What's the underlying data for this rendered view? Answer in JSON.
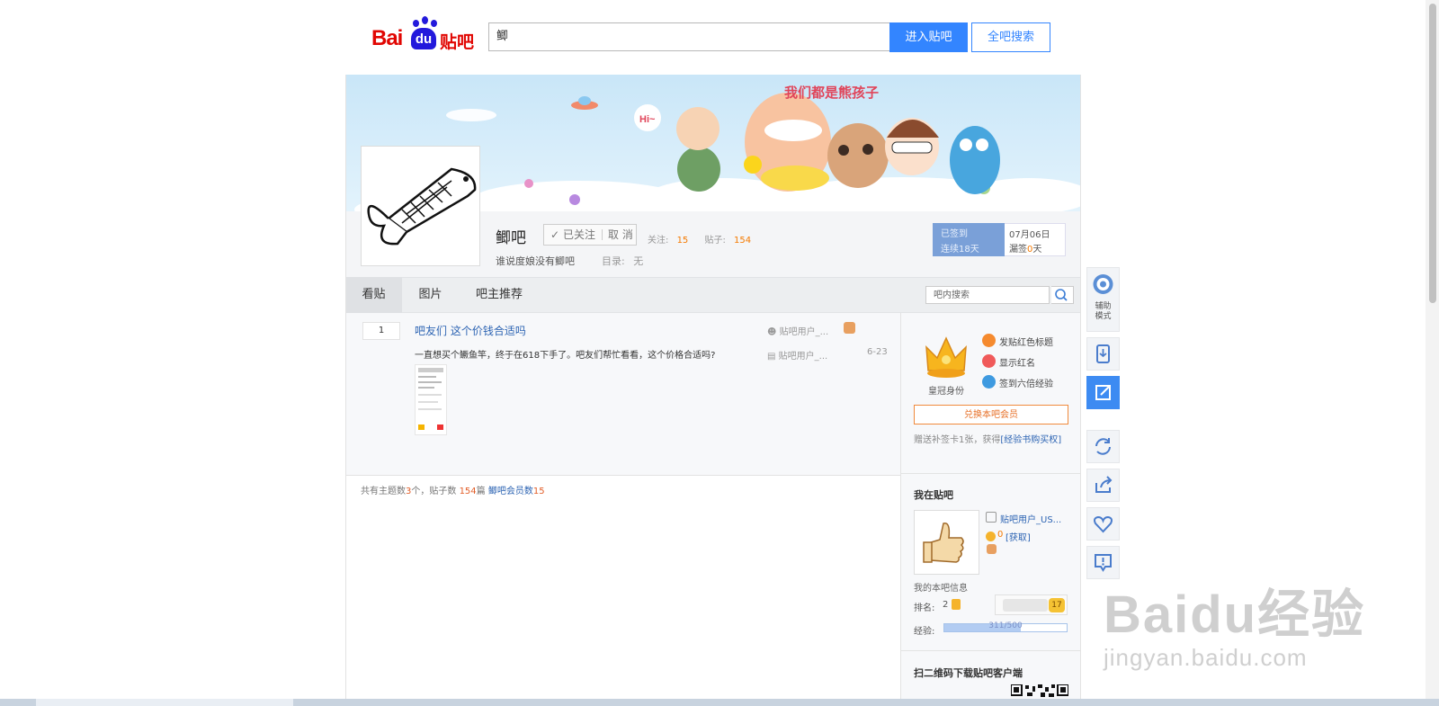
{
  "header": {
    "logo": {
      "bai": "Bai",
      "du": "du",
      "tieba": "贴吧"
    },
    "search_value": "鲫",
    "enter_button": "进入贴吧",
    "global_search_button": "全吧搜索"
  },
  "banner": {
    "slogan": "我们都是熊孩子",
    "bubble": "Hi~"
  },
  "forum": {
    "name": "鲫吧",
    "follow_label": "已关注",
    "unfollow_label": "取 消",
    "followers_label": "关注:",
    "followers": "15",
    "posts_label": "贴子:",
    "posts": "154",
    "slogan": "谁说度娘没有鲫吧",
    "catalog_label": "目录:",
    "catalog_value": "无",
    "sign": {
      "status": "已签到",
      "streak": "连续18天",
      "date": "07月06日",
      "missed_prefix": "漏签",
      "missed": "0",
      "missed_suffix": "天"
    }
  },
  "tabs": [
    {
      "label": "看贴"
    },
    {
      "label": "图片"
    },
    {
      "label": "吧主推荐"
    }
  ],
  "inner_search_placeholder": "吧内搜索",
  "threads": [
    {
      "replies": "1",
      "title": "吧友们 这个价钱合适吗",
      "abstract": "一直想买个鳜鱼竿，终于在618下手了。吧友们帮忙看看，这个价格合适吗?",
      "author": "贴吧用户_...",
      "last_replier": "贴吧用户_...",
      "date": "6-23"
    }
  ],
  "footer_stats": {
    "t1": "共有主题数",
    "topics": "3",
    "t2": "个，贴子数 ",
    "posts": "154",
    "t3": "篇 ",
    "member_link": "鲫吧会员数",
    "members": "15"
  },
  "aside": {
    "vip_label": "皇冠身份",
    "perks": [
      "发贴红色标题",
      "显示红名",
      "签到六倍经验"
    ],
    "member_button": "兑换本吧会员",
    "supp_prefix": "赠送补签卡1张，获得",
    "supp_link": "[经验书购买权]",
    "my_forum_title": "我在贴吧",
    "user_name": "贴吧用户_US...",
    "coins": "0",
    "get_link": "[获取]",
    "my_info_label": "我的本吧信息",
    "rank_label": "排名:",
    "rank": "2",
    "level_badge": "17",
    "exp_label": "经验:",
    "exp_text": "311/500",
    "exp_fraction": 0.622,
    "qr_title": "扫二维码下载贴吧客户端"
  },
  "side_tools": {
    "assist_line1": "辅助",
    "assist_line2": "模式"
  },
  "watermark": {
    "brand": "Baidu经验",
    "url": "jingyan.baidu.com"
  },
  "colors": {
    "accent": "#3385ff",
    "link": "#2d64b3",
    "orange": "#f57a00",
    "brand_red": "#e10602",
    "brand_blue": "#2319dc"
  }
}
